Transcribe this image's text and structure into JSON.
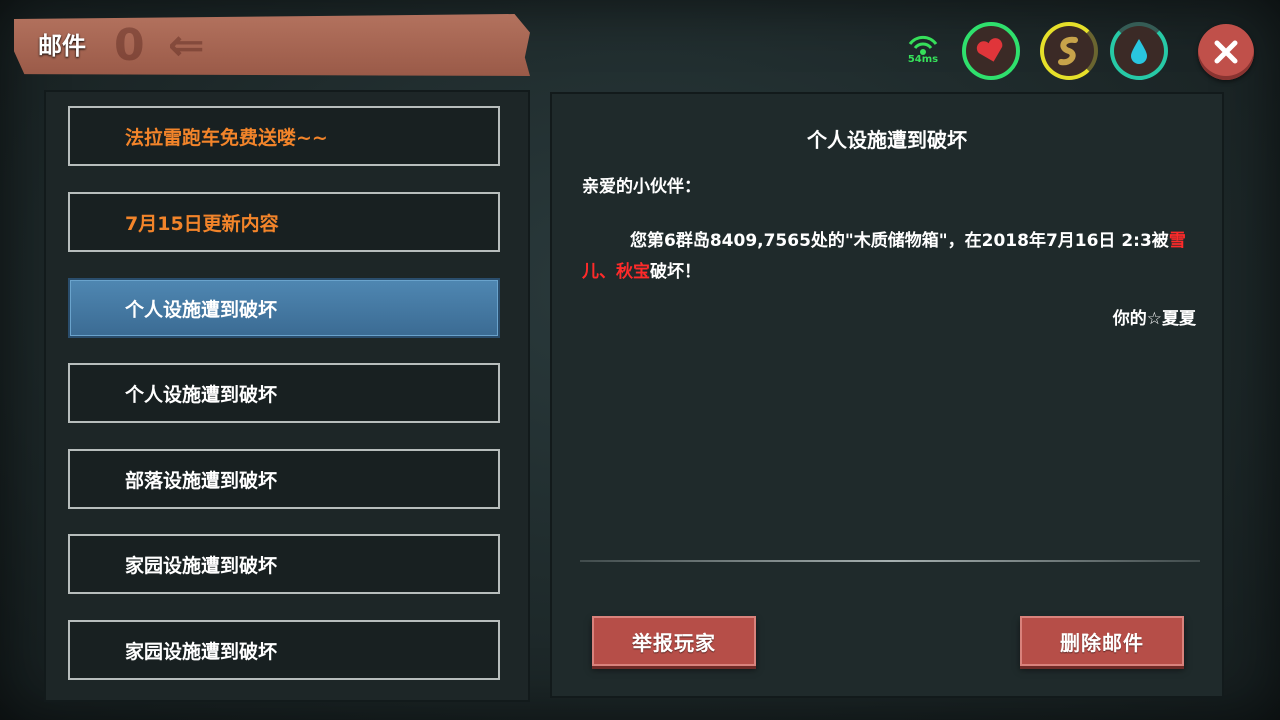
{
  "header": {
    "title": "邮件",
    "deco_text": "0 ⇐",
    "ping": "54ms"
  },
  "stats": {
    "heart_icon": "heart-icon",
    "food_icon": "food-icon",
    "water_icon": "water-drop-icon",
    "heart_color": "#2fe06d",
    "food_color": "#e6e02a",
    "water_color": "#27c9a6"
  },
  "mail_list": [
    {
      "title": "法拉雷跑车免费送喽~~",
      "color": "#f2842a"
    },
    {
      "title": "7月15日更新内容",
      "color": "#f2842a"
    },
    {
      "title": "个人设施遭到破坏",
      "selected": true
    },
    {
      "title": "个人设施遭到破坏"
    },
    {
      "title": "部落设施遭到破坏"
    },
    {
      "title": "家园设施遭到破坏"
    },
    {
      "title": "家园设施遭到破坏"
    }
  ],
  "mail_detail": {
    "title": "个人设施遭到破坏",
    "greeting": "亲爱的小伙伴：",
    "body_prefix": "您第6群岛8409,7565处的\"木质储物箱\"，在2018年7月16日 2:3被",
    "attackers": "雪儿、秋宝",
    "body_suffix": "破坏！",
    "signature": "你的☆夏夏",
    "highlight_color": "#ff2a2a"
  },
  "actions": {
    "report_label": "举报玩家",
    "delete_label": "删除邮件"
  }
}
